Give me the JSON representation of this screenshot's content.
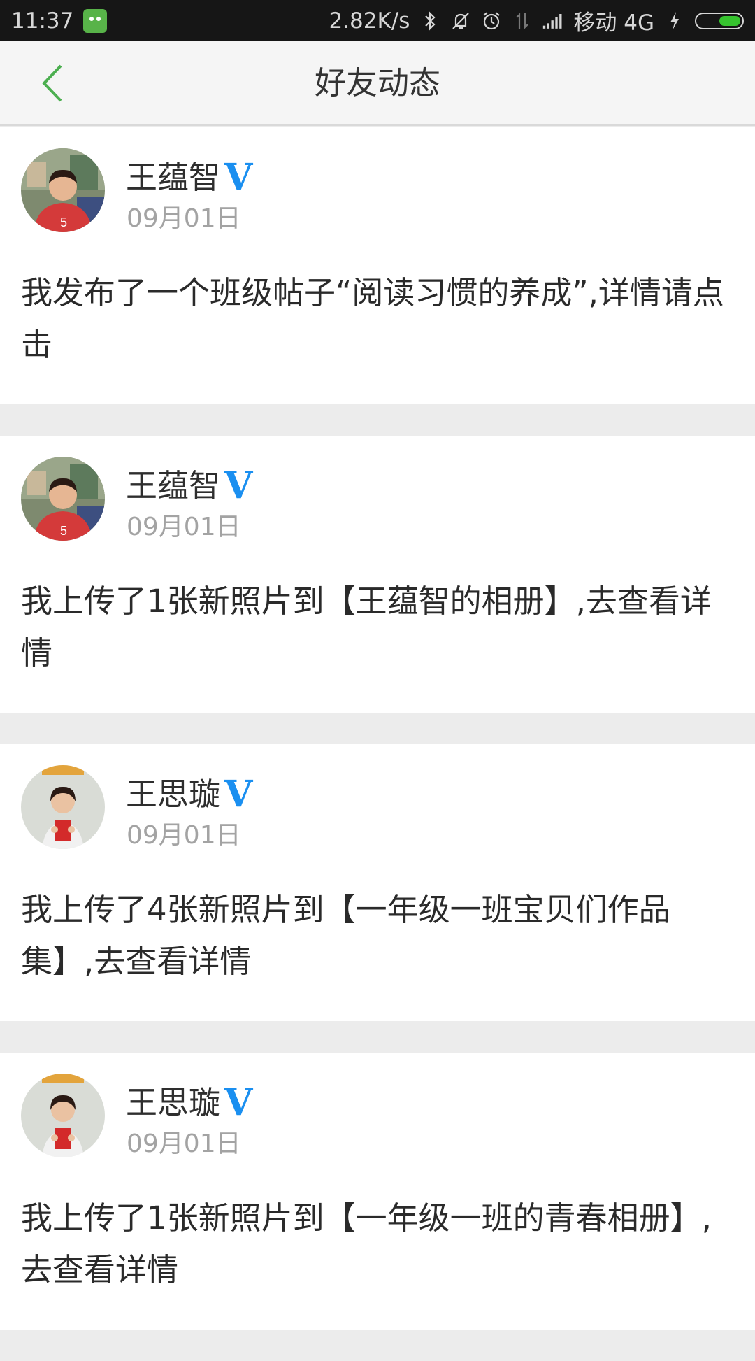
{
  "status_bar": {
    "time": "11:37",
    "net_speed": "2.82K/s",
    "carrier": "移动 4G",
    "icons": [
      "app-notification-icon",
      "bluetooth-icon",
      "silent-icon",
      "alarm-icon",
      "data-transfer-icon",
      "signal-icon",
      "charging-icon",
      "battery-icon"
    ],
    "battery_color": "#36c32e"
  },
  "header": {
    "title": "好友动态",
    "back_icon": "chevron-left-icon",
    "accent": "#4caf50"
  },
  "feed": [
    {
      "name": "王蕴智",
      "badge": "V",
      "date": "09月01日",
      "content": "我发布了一个班级帖子“阅读习惯的养成”,详情请点击",
      "avatar": "boy-red-shirt"
    },
    {
      "name": "王蕴智",
      "badge": "V",
      "date": "09月01日",
      "content": "我上传了1张新照片到【王蕴智的相册】,去查看详情",
      "avatar": "boy-red-shirt"
    },
    {
      "name": "王思璇",
      "badge": "V",
      "date": "09月01日",
      "content": "我上传了4张新照片到【一年级一班宝贝们作品集】,去查看详情",
      "avatar": "girl-holding-certificate"
    },
    {
      "name": "王思璇",
      "badge": "V",
      "date": "09月01日",
      "content": "我上传了1张新照片到【一年级一班的青春相册】,去查看详情",
      "avatar": "girl-holding-certificate"
    }
  ]
}
